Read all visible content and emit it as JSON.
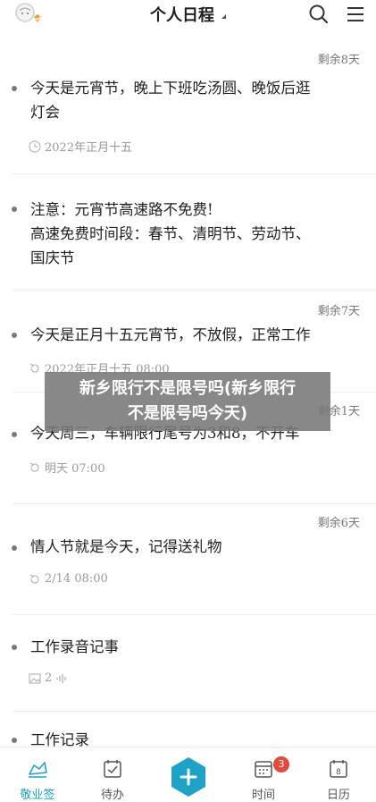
{
  "header": {
    "title": "个人日程"
  },
  "items": [
    {
      "remain": "剩余8天",
      "text_line1": "今天是元宵节，晚上下班吃汤圆、晚饭后逛",
      "text_line2": "灯会",
      "meta": "2022年正月十五"
    },
    {
      "text_line1": "注意：元宵节高速路不免费!",
      "text_line2": "高速免费时间段：春节、清明节、劳动节、",
      "text_line3": "国庆节"
    },
    {
      "remain": "剩余7天",
      "text_line1": "今天是正月十五元宵节，不放假，正常工作",
      "meta": "2022年正月十五  08:00"
    },
    {
      "remain": "剩余1天",
      "text_line1": "今天周三，车辆限行尾号为3和8，不开车",
      "meta": "明天  07:00"
    },
    {
      "remain": "剩余6天",
      "text_line1": "情人节就是今天，记得送礼物",
      "meta": "2/14  08:00"
    },
    {
      "text_line1": "工作录音记事",
      "meta": "2"
    },
    {
      "text_line1": "工作记录"
    }
  ],
  "overlay": {
    "line1": "新乡限行不是限号吗(新乡限行",
    "line2": "不是限号吗今天)"
  },
  "tabs": [
    {
      "label": "敬业签"
    },
    {
      "label": "待办"
    },
    {
      "label": "时间",
      "badge": "3"
    },
    {
      "label": "日历"
    }
  ],
  "colors": {
    "accent": "#1ca3c7",
    "badge": "#e5493a",
    "overlay": "#787878"
  }
}
